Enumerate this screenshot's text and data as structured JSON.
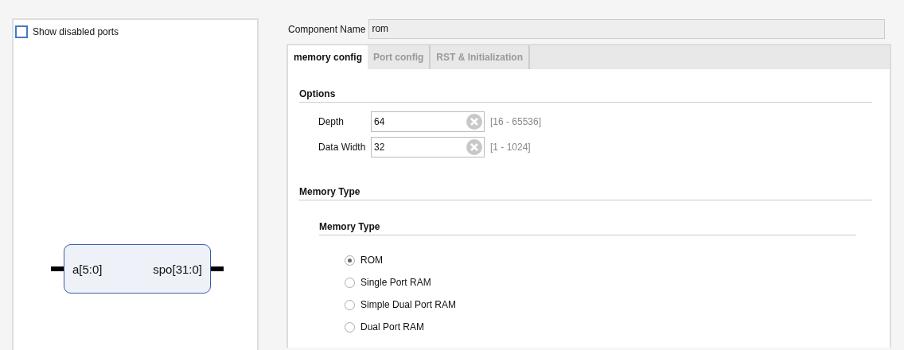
{
  "left_panel": {
    "show_disabled_ports": {
      "label": "Show disabled ports",
      "checked": false
    },
    "block": {
      "input_port": "a[5:0]",
      "output_port": "spo[31:0]"
    }
  },
  "component_name": {
    "label": "Component Name",
    "value": "rom"
  },
  "tabs": [
    {
      "label": "memory config",
      "selected": true
    },
    {
      "label": "Port config",
      "selected": false
    },
    {
      "label": "RST & Initialization",
      "selected": false
    }
  ],
  "options": {
    "title": "Options",
    "fields": [
      {
        "label": "Depth",
        "value": "64",
        "range": "[16 - 65536]"
      },
      {
        "label": "Data Width",
        "value": "32",
        "range": "[1 - 1024]"
      }
    ]
  },
  "memory_type": {
    "title": "Memory Type",
    "group_title": "Memory Type",
    "choices": [
      {
        "label": "ROM",
        "selected": true
      },
      {
        "label": "Single Port RAM",
        "selected": false
      },
      {
        "label": "Simple Dual Port RAM",
        "selected": false
      },
      {
        "label": "Dual Port RAM",
        "selected": false
      }
    ]
  }
}
